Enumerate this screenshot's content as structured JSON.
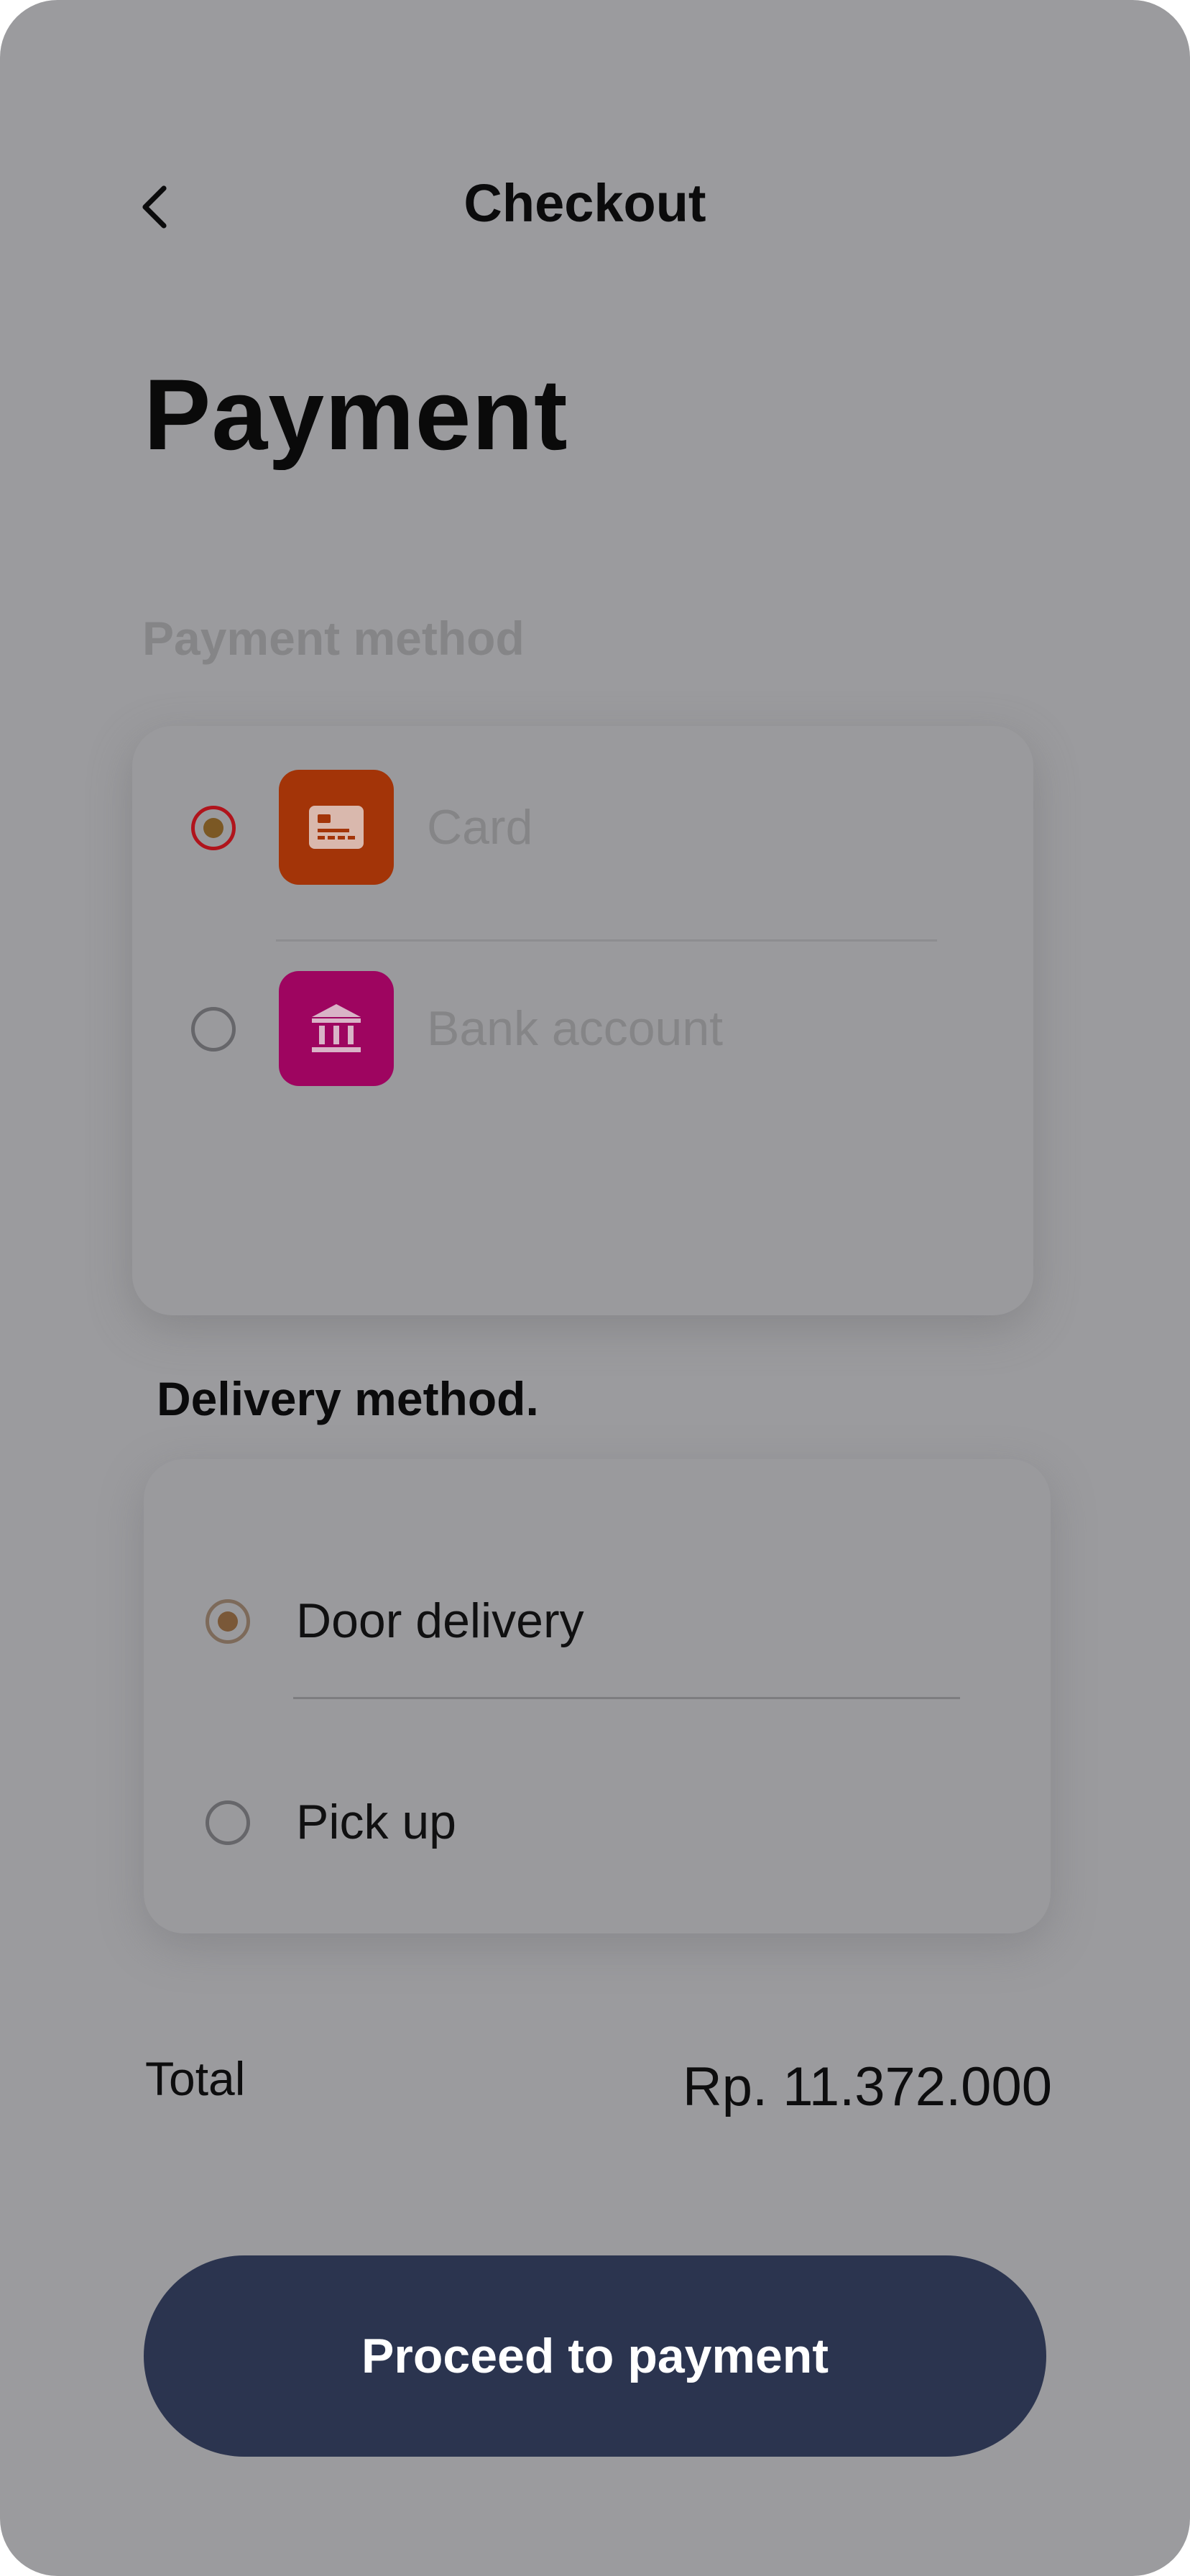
{
  "header": {
    "back_icon": "chevron-left-icon",
    "title": "Checkout"
  },
  "page": {
    "title": "Payment"
  },
  "payment": {
    "section_label": "Payment method",
    "options": [
      {
        "label": "Card",
        "icon": "credit-card-icon",
        "icon_bg": "#a33408",
        "selected": true
      },
      {
        "label": "Bank account",
        "icon": "bank-icon",
        "icon_bg": "#9e0560",
        "selected": false
      }
    ]
  },
  "delivery": {
    "section_label": "Delivery method.",
    "options": [
      {
        "label": "Door delivery",
        "selected": true
      },
      {
        "label": "Pick up",
        "selected": false
      }
    ]
  },
  "summary": {
    "total_label": "Total",
    "total_value": "Rp. 11.372.000"
  },
  "actions": {
    "proceed_label": "Proceed to payment"
  },
  "colors": {
    "background_overlay": "#9b9b9e",
    "primary_button": "#2b344f",
    "radio_selected_red": "#b0141c"
  }
}
